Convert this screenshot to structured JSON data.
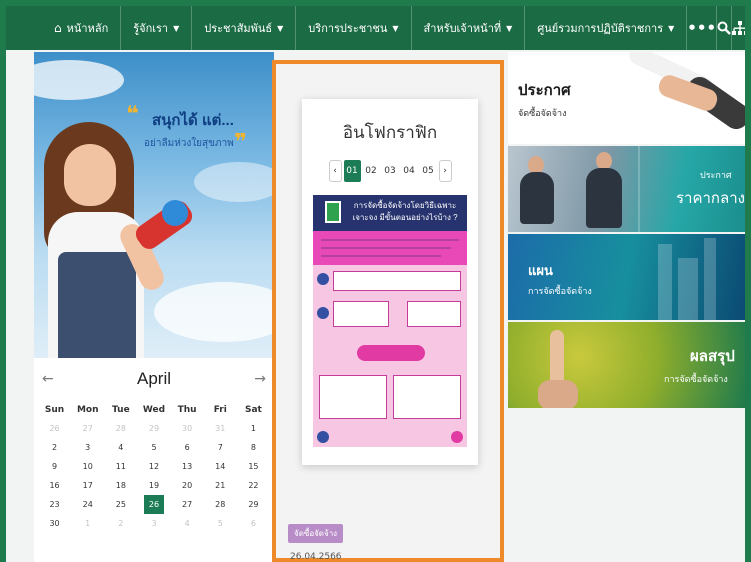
{
  "nav": {
    "items": [
      {
        "label": "หน้าหลัก",
        "dropdown": false,
        "icon": "home-icon"
      },
      {
        "label": "รู้จักเรา",
        "dropdown": true
      },
      {
        "label": "ประชาสัมพันธ์",
        "dropdown": true
      },
      {
        "label": "บริการประชาชน",
        "dropdown": true
      },
      {
        "label": "สำหรับเจ้าหน้าที่",
        "dropdown": true
      },
      {
        "label": "ศูนย์รวมการปฏิบัติราชการ",
        "dropdown": true
      }
    ],
    "more_label": "•••",
    "icons": [
      "more-icon",
      "search-icon",
      "sitemap-icon"
    ],
    "color": "#1b6b45"
  },
  "promo": {
    "line1": "สนุกได้ แต่...",
    "line2": "อย่าลืมห่วงใยสุขภาพ",
    "quote_open": "❝",
    "quote_close": "❞"
  },
  "calendar": {
    "month": "April",
    "prev": "←",
    "next": "→",
    "dow": [
      "Sun",
      "Mon",
      "Tue",
      "Wed",
      "Thu",
      "Fri",
      "Sat"
    ],
    "weeks": [
      [
        "26",
        "27",
        "28",
        "29",
        "30",
        "31",
        "1"
      ],
      [
        "2",
        "3",
        "4",
        "5",
        "6",
        "7",
        "8"
      ],
      [
        "9",
        "10",
        "11",
        "12",
        "13",
        "14",
        "15"
      ],
      [
        "16",
        "17",
        "18",
        "19",
        "20",
        "21",
        "22"
      ],
      [
        "23",
        "24",
        "25",
        "26",
        "27",
        "28",
        "29"
      ],
      [
        "30",
        "1",
        "2",
        "3",
        "4",
        "5",
        "6"
      ]
    ],
    "today": "26",
    "accent": "#1b7c56"
  },
  "infographic": {
    "title": "อินโฟกราฟิก",
    "pages": [
      "01",
      "02",
      "03",
      "04",
      "05"
    ],
    "active_page": "01",
    "prev": "‹",
    "next": "›",
    "poster_heading": "การจัดซื้อจัดจ้างโดยวิธีเฉพาะเจาะจง มีขั้นตอนอย่างไรบ้าง ?",
    "tag": "จัดซื้อจัดจ้าง",
    "date": "26.04.2566",
    "border_color": "#ef8a2b"
  },
  "banners": [
    {
      "title": "ประกาศ",
      "subtitle": "จัดซื้อจัดจ้าง"
    },
    {
      "title": "ราคากลาง",
      "subtitle": "ประกาศ"
    },
    {
      "title": "แผน",
      "subtitle": "การจัดซื้อจัดจ้าง"
    },
    {
      "title": "ผลสรุป",
      "subtitle": "การจัดซื้อจัดจ้าง"
    }
  ]
}
